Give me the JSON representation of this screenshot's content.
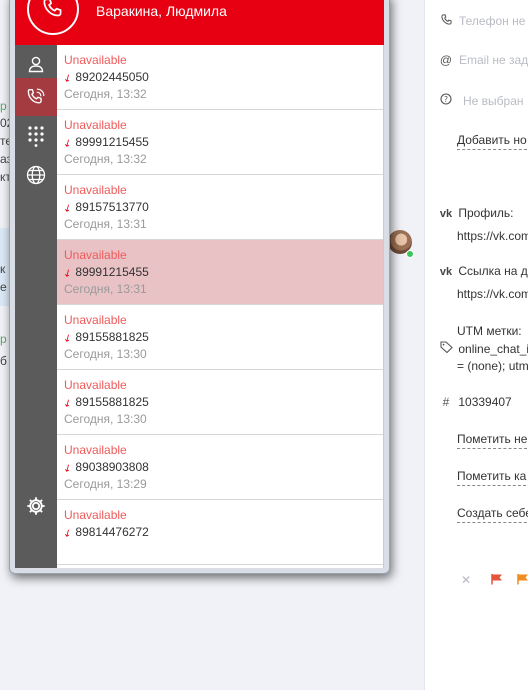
{
  "phone": {
    "contact_name": "Варакина, Людмила",
    "calls": [
      {
        "status": "Unavailable",
        "number": "89202445050",
        "time": "Сегодня, 13:32"
      },
      {
        "status": "Unavailable",
        "number": "89991215455",
        "time": "Сегодня, 13:32"
      },
      {
        "status": "Unavailable",
        "number": "89157513770",
        "time": "Сегодня, 13:31"
      },
      {
        "status": "Unavailable",
        "number": "89991215455",
        "time": "Сегодня, 13:31"
      },
      {
        "status": "Unavailable",
        "number": "89155881825",
        "time": "Сегодня, 13:30"
      },
      {
        "status": "Unavailable",
        "number": "89155881825",
        "time": "Сегодня, 13:30"
      },
      {
        "status": "Unavailable",
        "number": "89038903808",
        "time": "Сегодня, 13:29"
      },
      {
        "status": "Unavailable",
        "number": "89814476272",
        "time": ""
      }
    ],
    "selected_index": 3,
    "icons": [
      "user-icon",
      "call-history-icon",
      "dialpad-icon",
      "globe-icon",
      "settings-icon"
    ],
    "colors": {
      "accent": "#e60012",
      "missed": "#f05a5a",
      "sidebar": "#5b5b5b",
      "selected_row": "#e8c2c5"
    }
  },
  "customer": {
    "phone_placeholder": "Телефон не",
    "email_placeholder": "Email не зад",
    "select_placeholder": "Не выбран",
    "add_link": "Добавить но",
    "profile_label": "Профиль:",
    "profile_url": "https://vk.com",
    "dialog_label": "Ссылка на ди",
    "dialog_url": "https://vk.com",
    "utm_label": "UTM метки:",
    "utm_line1": "online_chat_i",
    "utm_line2": "= (none); utm",
    "id_value": "10339407",
    "mark_link_1": "Пометить не",
    "mark_link_2": "Пометить ка",
    "create_link": "Создать себе"
  },
  "background_chat": {
    "frag1": "р",
    "frag2": "02",
    "frag3": "те",
    "frag4": "аз",
    "frag5": "кт",
    "frag6": "к",
    "frag7": "е",
    "frag8": "р",
    "frag9": "б"
  }
}
